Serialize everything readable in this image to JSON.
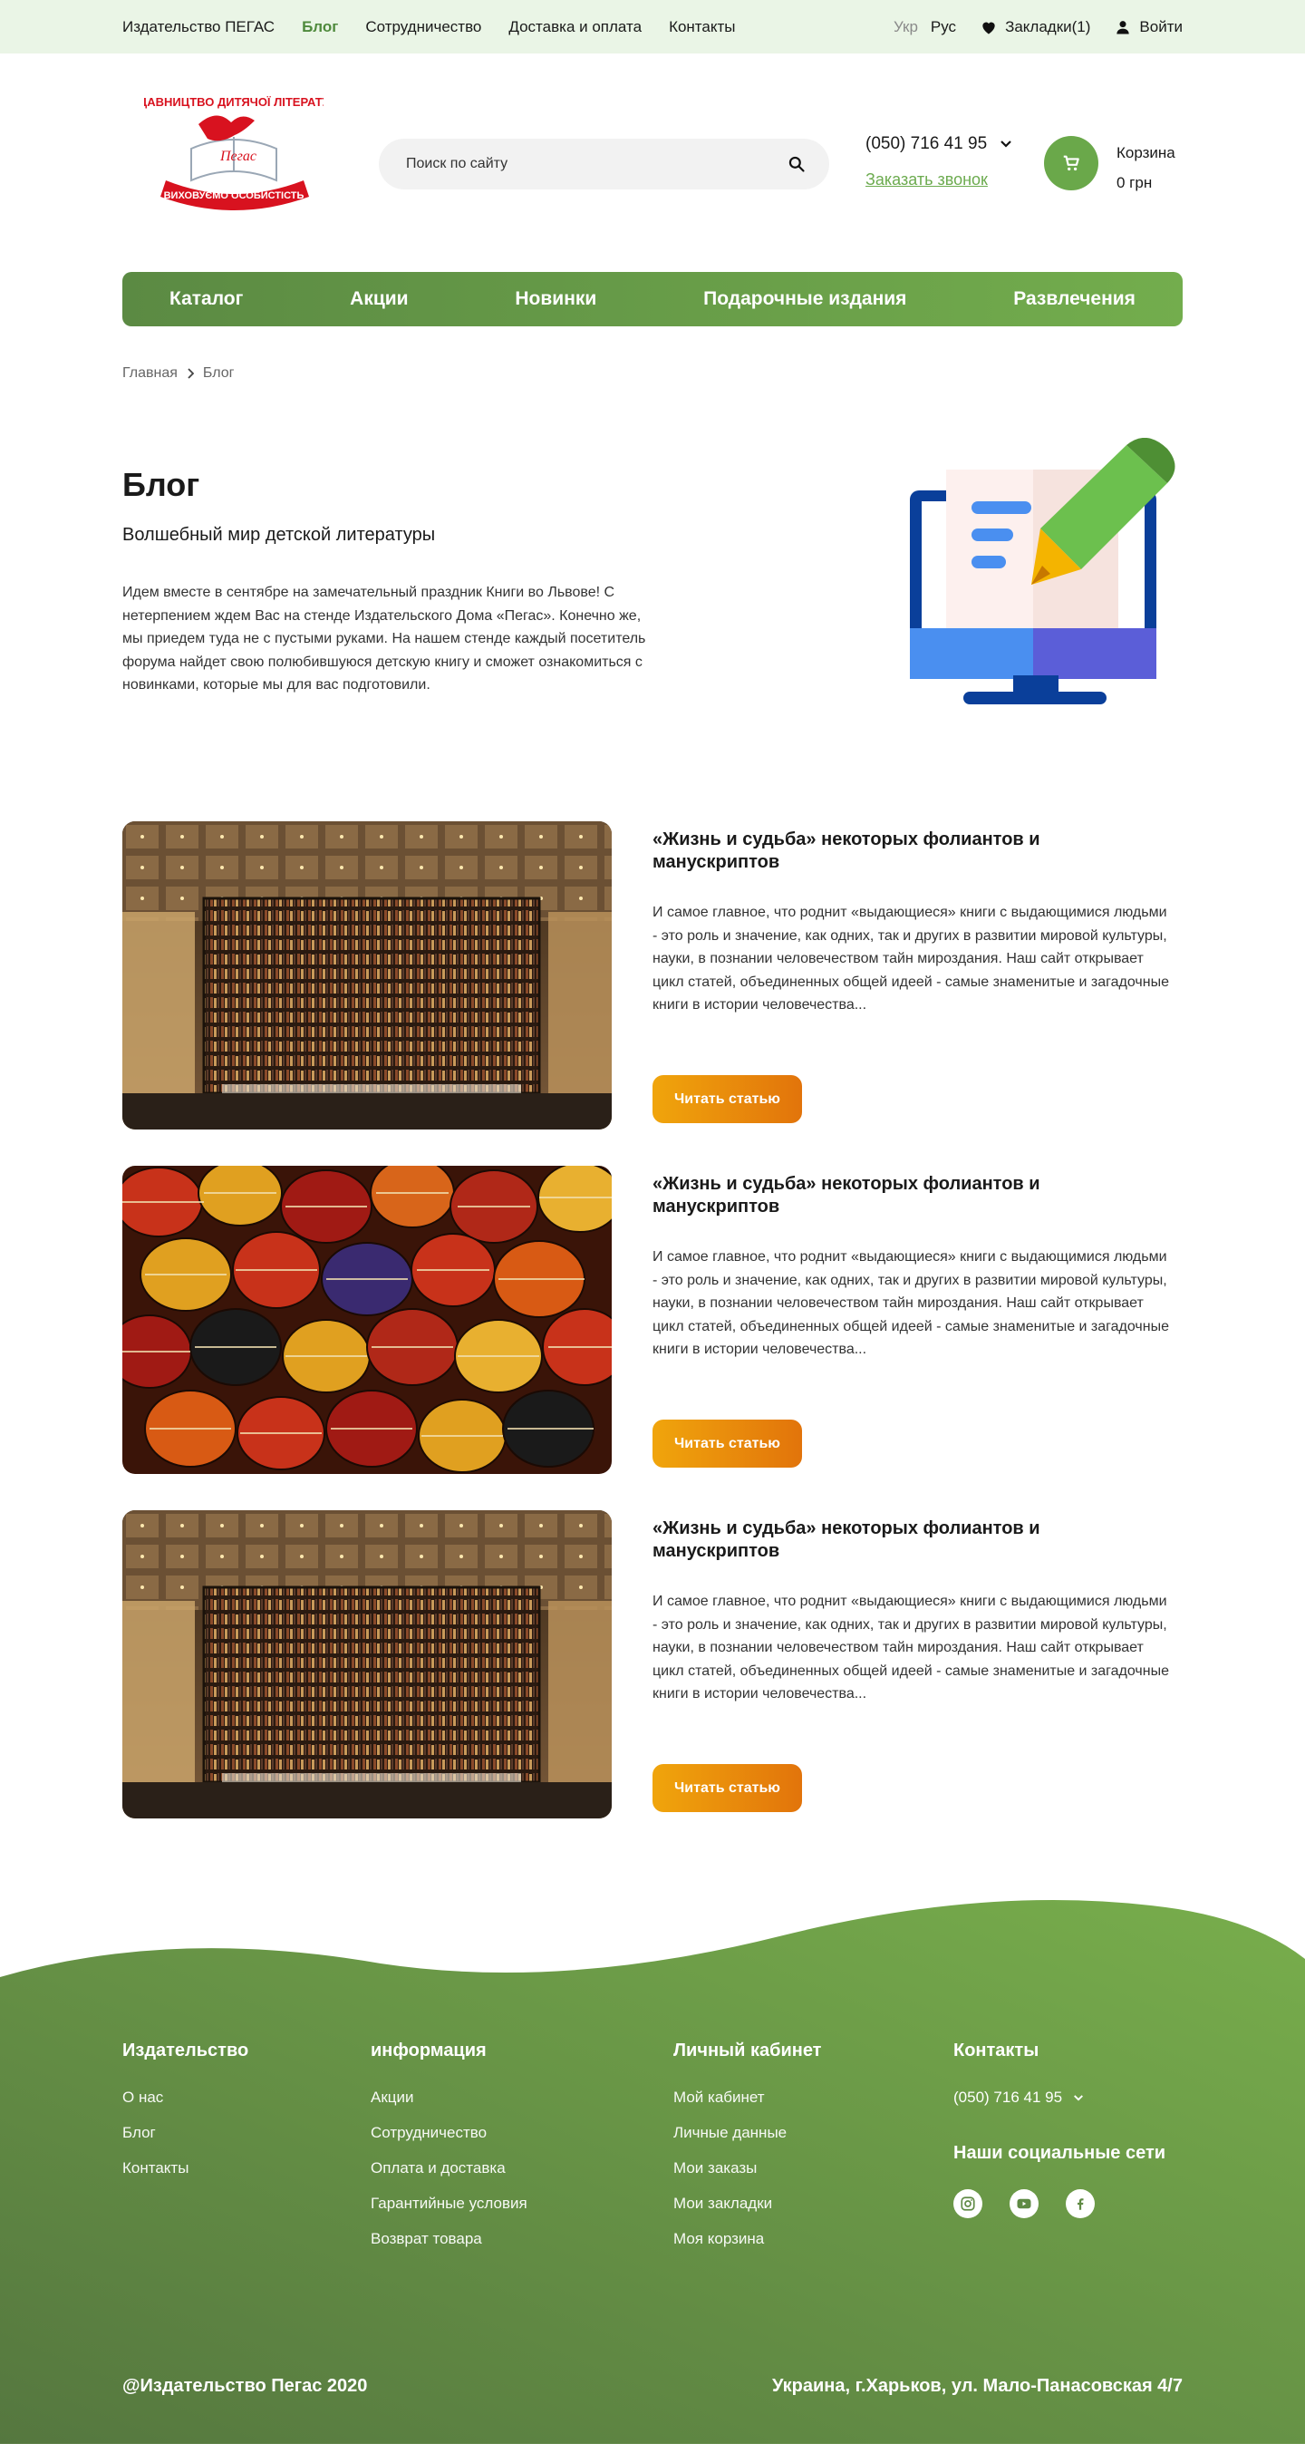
{
  "topbar": {
    "nav": [
      "Издательство ПЕГАС",
      "Блог",
      "Сотрудничество",
      "Доставка и оплата",
      "Контакты"
    ],
    "lang_ukr": "Укр",
    "lang_rus": "Рус",
    "bookmarks": "Закладки(1)",
    "login": "Войти"
  },
  "header": {
    "search_placeholder": "Поиск по сайту",
    "phone": "(050) 716 41 95",
    "callback": "Заказать звонок",
    "cart_label": "Корзина",
    "cart_total": "0 грн"
  },
  "mainnav": [
    "Каталог",
    "Акции",
    "Новинки",
    "Подарочные издания",
    "Развлечения"
  ],
  "breadcrumb": {
    "home": "Главная",
    "current": "Блог"
  },
  "intro": {
    "title": "Блог",
    "subtitle": "Волшебный мир детской литературы",
    "description": "Идем вместе в сентябре на замечательный праздник Книги во Львове! С нетерпением ждем Вас на стенде Издательского Дома «Пегас». Конечно же, мы приедем туда не с пустыми руками. На нашем стенде каждый посетитель форума найдет свою полюбившуюся детскую книгу и сможет ознакомиться с новинками, которые мы для вас подготовили."
  },
  "articles": [
    {
      "title": "«Жизнь и судьба» некоторых фолиантов и манускриптов",
      "text": "И самое главное, что роднит «выдающиеся» книги с выдающимися людьми - это роль и значение, как одних, так и других в развитии мировой культуры, науки, в познании человечеством тайн мироздания. Наш сайт открывает цикл статей, объединенных общей идеей - самые знаменитые и загадочные книги в истории человечества...",
      "button": "Читать статью",
      "image": "library-photo"
    },
    {
      "title": "«Жизнь и судьба» некоторых фолиантов и манускриптов",
      "text": "И самое главное, что роднит «выдающиеся» книги с выдающимися людьми - это роль и значение, как одних, так и других в развитии мировой культуры, науки, в познании человечеством тайн мироздания. Наш сайт открывает цикл статей, объединенных общей идеей - самые знаменитые и загадочные книги в истории человечества...",
      "button": "Читать статью",
      "image": "easter-eggs-photo"
    },
    {
      "title": "«Жизнь и судьба» некоторых фолиантов и манускриптов",
      "text": "И самое главное, что роднит «выдающиеся» книги с выдающимися людьми - это роль и значение, как одних, так и других в развитии мировой культуры, науки, в познании человечеством тайн мироздания. Наш сайт открывает цикл статей, объединенных общей идеей - самые знаменитые и загадочные книги в истории человечества...",
      "button": "Читать статью",
      "image": "library-photo"
    }
  ],
  "footer": {
    "publisher": {
      "title": "Издательство",
      "links": [
        "О нас",
        "Блог",
        "Контакты"
      ]
    },
    "info": {
      "title": "информация",
      "links": [
        "Акции",
        "Сотрудничество",
        "Оплата и доставка",
        "Гарантийные условия",
        "Возврат товара"
      ]
    },
    "account": {
      "title": "Личный кабинет",
      "links": [
        "Мой кабинет",
        "Личные данные",
        "Мои заказы",
        "Мои закладки",
        "Моя корзина"
      ]
    },
    "contacts": {
      "title": "Контакты",
      "phone": "(050) 716 41 95",
      "socials_title": "Наши социальные сети"
    },
    "copyright": "@Издательство Пегас 2020",
    "address": "Украина,  г.Харьков, ул. Мало-Панасовская 4/7"
  },
  "colors": {
    "green": "#6aa84a",
    "dark_green": "#5b8a43",
    "orange": "#e88a0b",
    "topbar_bg": "#eaf5e6"
  }
}
